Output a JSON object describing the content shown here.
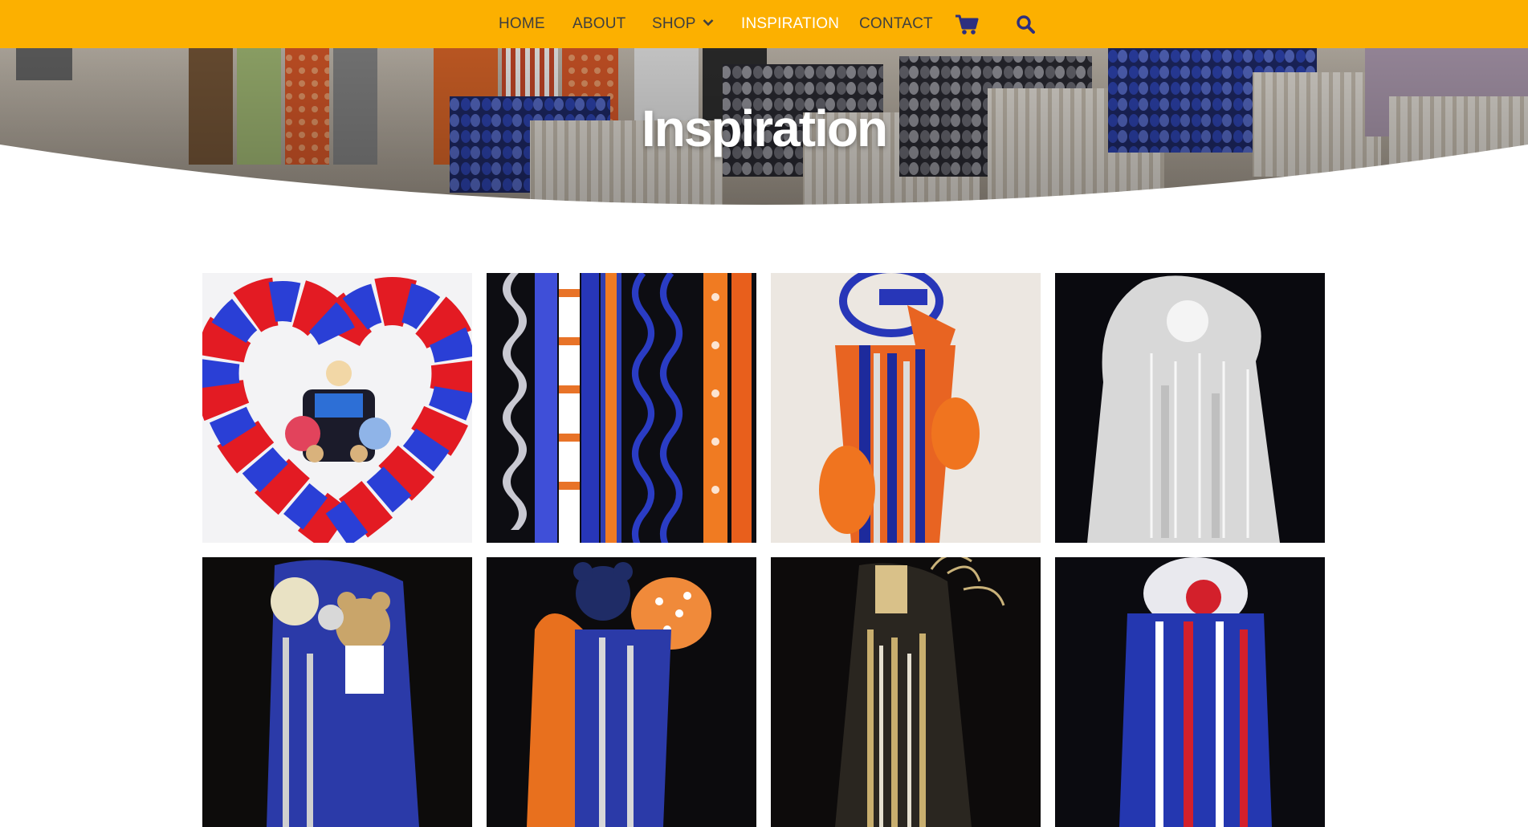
{
  "nav": {
    "items": [
      {
        "label": "HOME",
        "active": false
      },
      {
        "label": "ABOUT",
        "active": false
      },
      {
        "label": "SHOP",
        "active": false,
        "has_dropdown": true
      },
      {
        "label": "INSPIRATION",
        "active": true
      },
      {
        "label": "CONTACT",
        "active": false
      }
    ],
    "cart_icon": "shopping-cart-icon",
    "search_icon": "search-icon"
  },
  "hero": {
    "title": "Inspiration"
  },
  "gallery": {
    "images": [
      {
        "name": "gallery-image-red-blue-heart-boa"
      },
      {
        "name": "gallery-image-ribbon-braids"
      },
      {
        "name": "gallery-image-orange-blue-2021-mum"
      },
      {
        "name": "gallery-image-white-silver-mum"
      },
      {
        "name": "gallery-image-blue-white-bear-mum"
      },
      {
        "name": "gallery-image-orange-blue-bear-mum"
      },
      {
        "name": "gallery-image-gold-black-mum"
      },
      {
        "name": "gallery-image-red-white-blue-mum"
      }
    ]
  },
  "colors": {
    "nav_bg": "#fcb000",
    "nav_text": "#3f3f3f",
    "nav_active": "#ffffff",
    "icon": "#2d2f7f"
  }
}
